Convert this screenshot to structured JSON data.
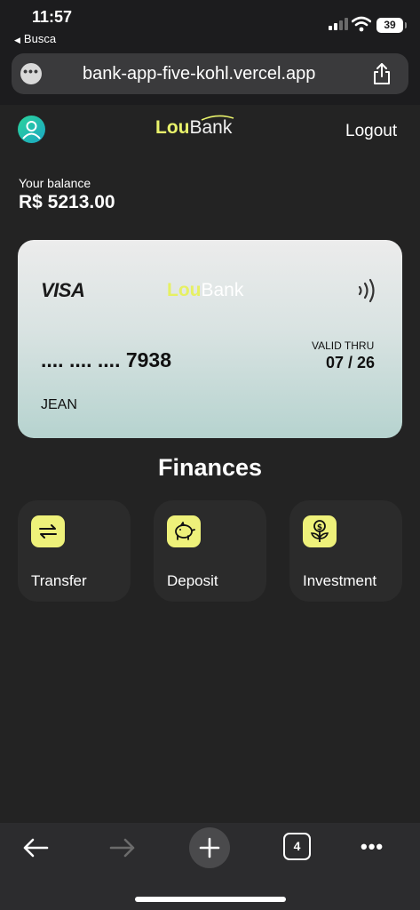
{
  "status_bar": {
    "time": "11:57",
    "back_label": "Busca",
    "battery": "39"
  },
  "browser": {
    "url": "bank-app-five-kohl.vercel.app",
    "tab_count": "4"
  },
  "app": {
    "logo_part1": "Lou",
    "logo_part2": "Bank",
    "logout_label": "Logout",
    "balance_label": "Your balance",
    "balance_value": "R$ 5213.00"
  },
  "card": {
    "brand": "VISA",
    "logo_part1": "Lou",
    "logo_part2": "Bank",
    "number": ".... .... .... 7938",
    "valid_label": "VALID THRU",
    "valid_value": "07 / 26",
    "holder": "JEAN"
  },
  "finances": {
    "title": "Finances",
    "items": [
      {
        "label": "Transfer",
        "icon": "transfer-arrows-icon"
      },
      {
        "label": "Deposit",
        "icon": "piggy-bank-icon"
      },
      {
        "label": "Investment",
        "icon": "money-plant-icon"
      }
    ]
  },
  "colors": {
    "accent": "#eef17a",
    "background": "#232323",
    "tile": "#2b2b2b"
  }
}
